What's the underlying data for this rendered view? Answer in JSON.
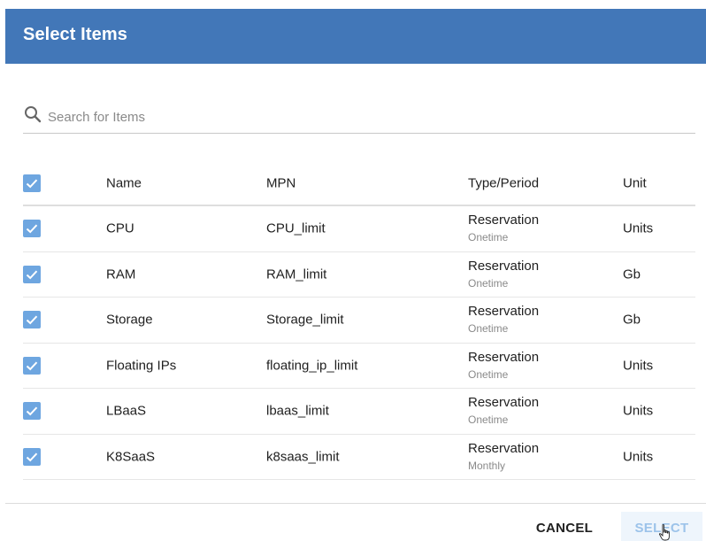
{
  "dialog": {
    "title": "Select Items"
  },
  "search": {
    "placeholder": "Search for Items",
    "value": "",
    "icon": "search-icon"
  },
  "table": {
    "headers": {
      "select_all_checked": true,
      "name": "Name",
      "mpn": "MPN",
      "type_period": "Type/Period",
      "unit": "Unit"
    },
    "rows": [
      {
        "checked": true,
        "name": "CPU",
        "mpn": "CPU_limit",
        "type": "Reservation",
        "period": "Onetime",
        "unit": "Units"
      },
      {
        "checked": true,
        "name": "RAM",
        "mpn": "RAM_limit",
        "type": "Reservation",
        "period": "Onetime",
        "unit": "Gb"
      },
      {
        "checked": true,
        "name": "Storage",
        "mpn": "Storage_limit",
        "type": "Reservation",
        "period": "Onetime",
        "unit": "Gb"
      },
      {
        "checked": true,
        "name": "Floating IPs",
        "mpn": "floating_ip_limit",
        "type": "Reservation",
        "period": "Onetime",
        "unit": "Units"
      },
      {
        "checked": true,
        "name": "LBaaS",
        "mpn": "lbaas_limit",
        "type": "Reservation",
        "period": "Onetime",
        "unit": "Units"
      },
      {
        "checked": true,
        "name": "K8SaaS",
        "mpn": "k8saas_limit",
        "type": "Reservation",
        "period": "Monthly",
        "unit": "Units"
      }
    ]
  },
  "footer": {
    "cancel_label": "CANCEL",
    "select_label": "SELECT"
  },
  "colors": {
    "header_bg": "#4277b8",
    "checkbox": "#6ea6e0",
    "select_text": "#9cc3ea"
  }
}
